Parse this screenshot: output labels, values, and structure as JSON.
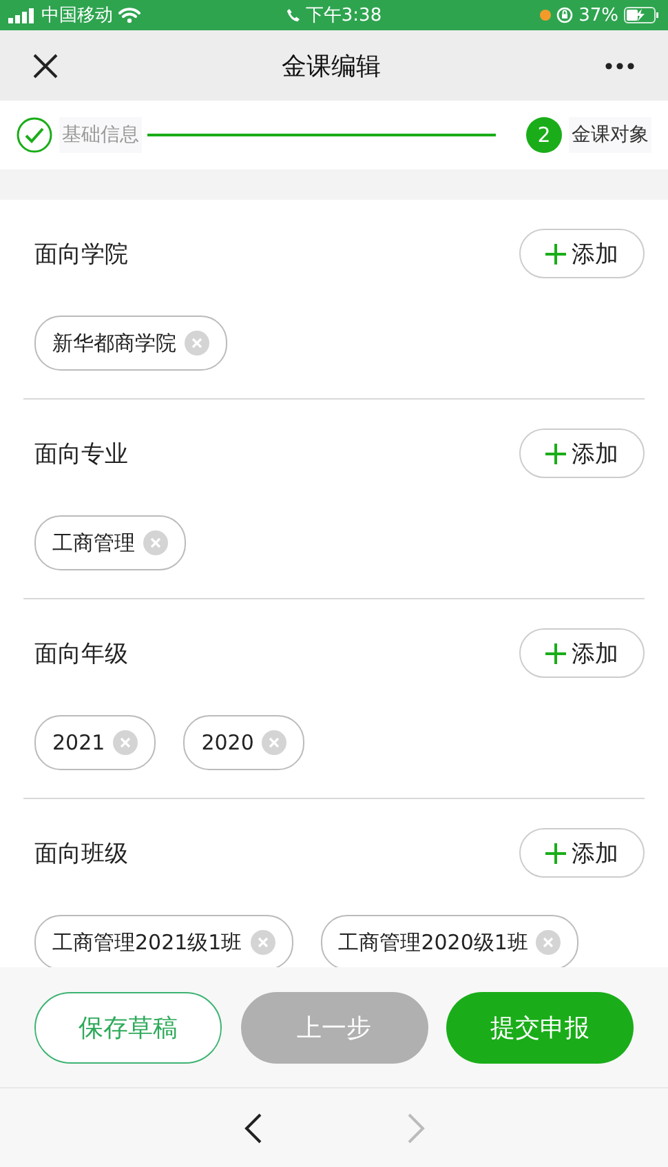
{
  "status_bar": {
    "carrier": "中国移动",
    "time": "下午3:38",
    "battery": "37%"
  },
  "nav": {
    "title": "金课编辑"
  },
  "steps": [
    {
      "label": "基础信息",
      "done": true
    },
    {
      "number": "2",
      "label": "金课对象",
      "done": false
    }
  ],
  "sections": [
    {
      "title": "面向学院",
      "add_label": "添加",
      "tags": [
        "新华都商学院"
      ]
    },
    {
      "title": "面向专业",
      "add_label": "添加",
      "tags": [
        "工商管理"
      ]
    },
    {
      "title": "面向年级",
      "add_label": "添加",
      "tags": [
        "2021",
        "2020"
      ]
    },
    {
      "title": "面向班级",
      "add_label": "添加",
      "tags": [
        "工商管理2021级1班",
        "工商管理2020级1班"
      ]
    }
  ],
  "buttons": [
    {
      "label": "保存草稿",
      "kind": "outline",
      "disabled": false
    },
    {
      "label": "上一步",
      "kind": "plain",
      "disabled": true
    },
    {
      "label": "提交申报",
      "kind": "primary",
      "disabled": false
    }
  ],
  "browser_nav": {
    "back_disabled": false,
    "forward_disabled": true
  }
}
